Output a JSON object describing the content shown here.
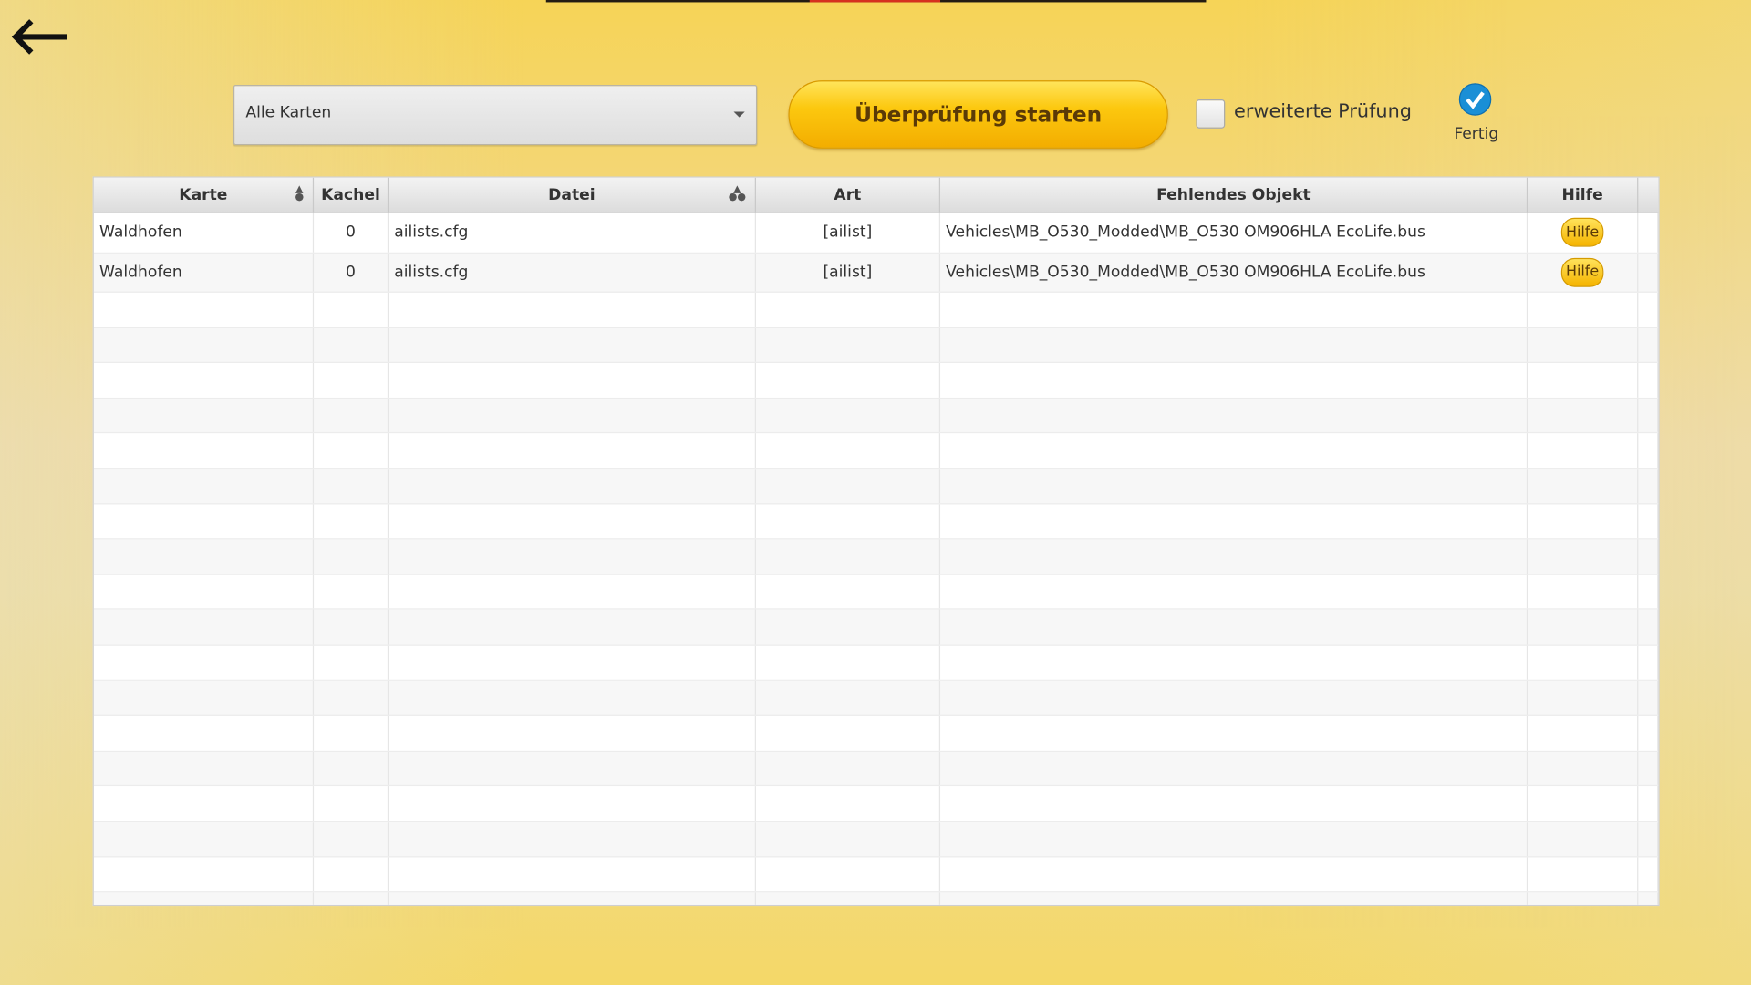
{
  "toolbar": {
    "map_select": "Alle Karten",
    "start_button": "Überprüfung starten",
    "extended_check_label": "erweiterte Prüfung",
    "extended_check_checked": false,
    "status_label": "Fertig",
    "progress": 1.0
  },
  "table": {
    "columns": [
      "Karte",
      "Kachel",
      "Datei",
      "Art",
      "Fehlendes Objekt",
      "Hilfe"
    ],
    "rows": [
      {
        "karte": "Waldhofen",
        "kachel": "0",
        "datei": "ailists.cfg",
        "art": "[ailist]",
        "objekt": "Vehicles\\MB_O530_Modded\\MB_O530 OM906HLA EcoLife.bus",
        "hilfe": "Hilfe"
      },
      {
        "karte": "Waldhofen",
        "kachel": "0",
        "datei": "ailists.cfg",
        "art": "[ailist]",
        "objekt": "Vehicles\\MB_O530_Modded\\MB_O530 OM906HLA EcoLife.bus",
        "hilfe": "Hilfe"
      }
    ]
  },
  "colors": {
    "accent": "#f5b400",
    "check": "#1a8fd6"
  }
}
